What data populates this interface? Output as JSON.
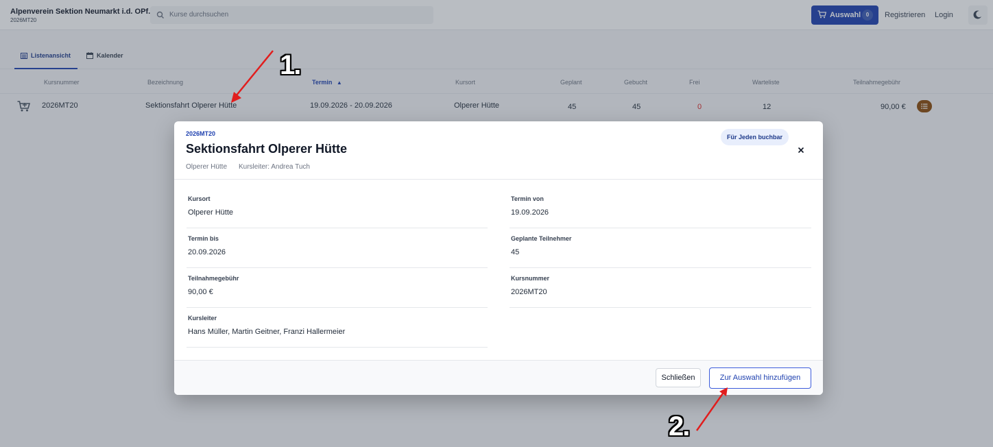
{
  "header": {
    "org_name": "Alpenverein Sektion Neumarkt i.d. OPf.",
    "org_sub": "2026MT20",
    "search_placeholder": "Kurse durchsuchen",
    "auswahl_label": "Auswahl",
    "auswahl_count": "0",
    "register_label": "Registrieren",
    "login_label": "Login"
  },
  "tabs": [
    {
      "label": "Listenansicht",
      "active": true,
      "icon": "list-icon"
    },
    {
      "label": "Kalender",
      "active": false,
      "icon": "calendar-icon"
    }
  ],
  "table": {
    "columns": [
      "Kursnummer",
      "Bezeichnung",
      "Termin",
      "Kursort",
      "Geplant",
      "Gebucht",
      "Frei",
      "Warteliste",
      "Teilnahmegebühr"
    ],
    "sort_column": "Termin",
    "row": {
      "kursnummer": "2026MT20",
      "bezeichnung": "Sektionsfahrt Olperer Hütte",
      "termin": "19.09.2026 - 20.09.2026",
      "kursort": "Olperer Hütte",
      "geplant": "45",
      "gebucht": "45",
      "frei": "0",
      "warteliste": "12",
      "gebuehr": "90,00 €"
    }
  },
  "modal": {
    "code": "2026MT20",
    "title": "Sektionsfahrt Olperer Hütte",
    "place": "Olperer Hütte",
    "leader": "Kursleiter: Andrea Tuch",
    "badge": "Für Jeden buchbar",
    "fields": [
      {
        "label": "Kursort",
        "value": "Olperer Hütte"
      },
      {
        "label": "Termin von",
        "value": "19.09.2026"
      },
      {
        "label": "Termin bis",
        "value": "20.09.2026"
      },
      {
        "label": "Geplante Teilnehmer",
        "value": "45"
      },
      {
        "label": "Teilnahmegebühr",
        "value": "90,00 €"
      },
      {
        "label": "Kursnummer",
        "value": "2026MT20"
      },
      {
        "label": "Kursleiter",
        "value": "Hans Müller, Martin Geitner, Franzi Hallermeier"
      }
    ],
    "close_label": "Schließen",
    "add_label": "Zur Auswahl hinzufügen"
  },
  "annotations": {
    "step1": "1.",
    "step2": "2."
  },
  "colors": {
    "primary": "#1e40af",
    "frei_red": "#dc2626",
    "menu_brown": "#8a4b0a",
    "arrow_red": "#e11d1d"
  }
}
